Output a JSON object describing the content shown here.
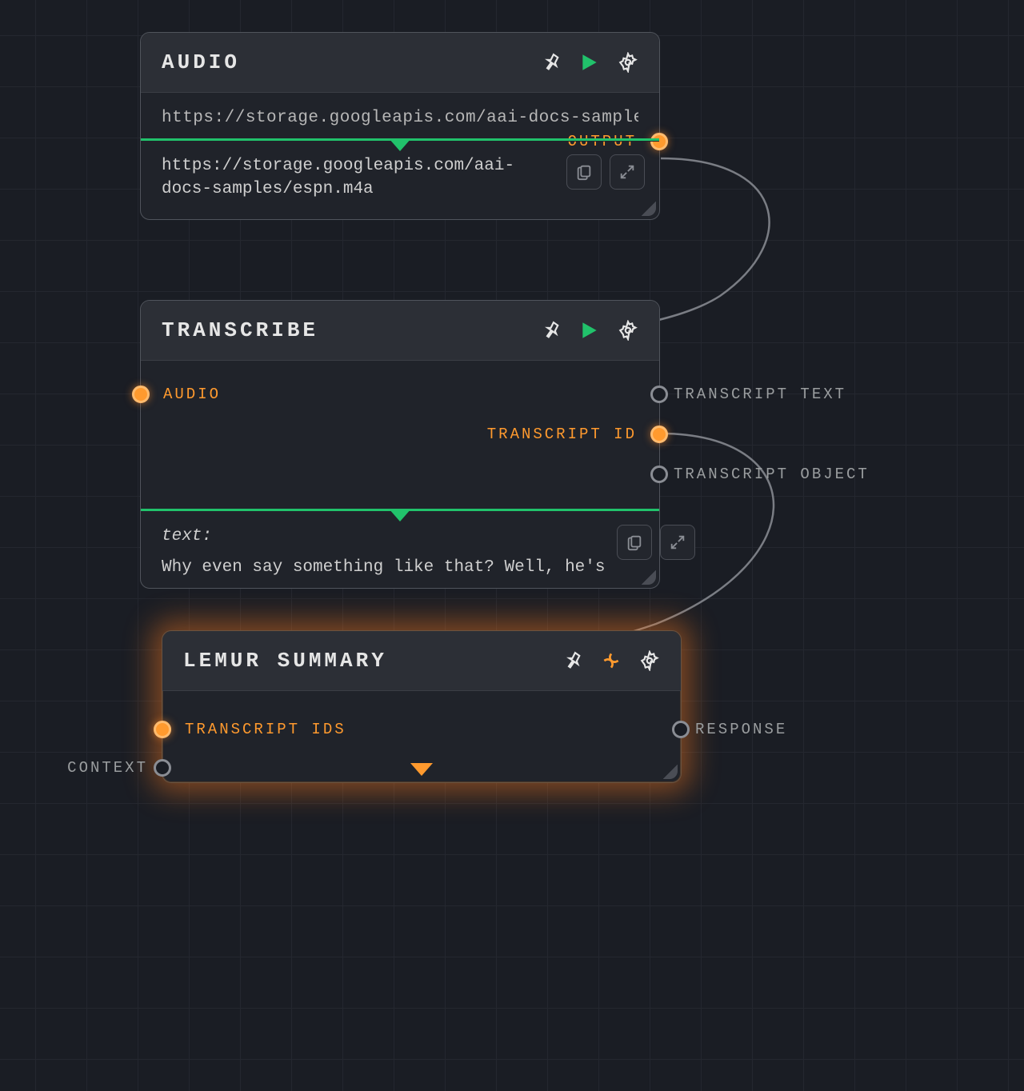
{
  "nodes": {
    "audio": {
      "title": "AUDIO",
      "input_text": "https://storage.googleapis.com/aai-docs-samples,",
      "output_label": "OUTPUT",
      "output_text": "https://storage.googleapis.com/aai-docs-samples/espn.m4a"
    },
    "transcribe": {
      "title": "TRANSCRIBE",
      "input_port": "AUDIO",
      "out_transcript_text": "TRANSCRIPT TEXT",
      "out_transcript_id": "TRANSCRIPT ID",
      "out_transcript_object": "TRANSCRIPT OBJECT",
      "result_label": "text:",
      "result_preview": "Why even say something like that? Well, he's"
    },
    "lemur": {
      "title": "LEMUR SUMMARY",
      "in_transcript_ids": "TRANSCRIPT IDS",
      "in_context": "CONTEXT",
      "out_response": "RESPONSE"
    }
  },
  "colors": {
    "accent_green": "#21c26b",
    "accent_orange": "#ff9a2e"
  }
}
